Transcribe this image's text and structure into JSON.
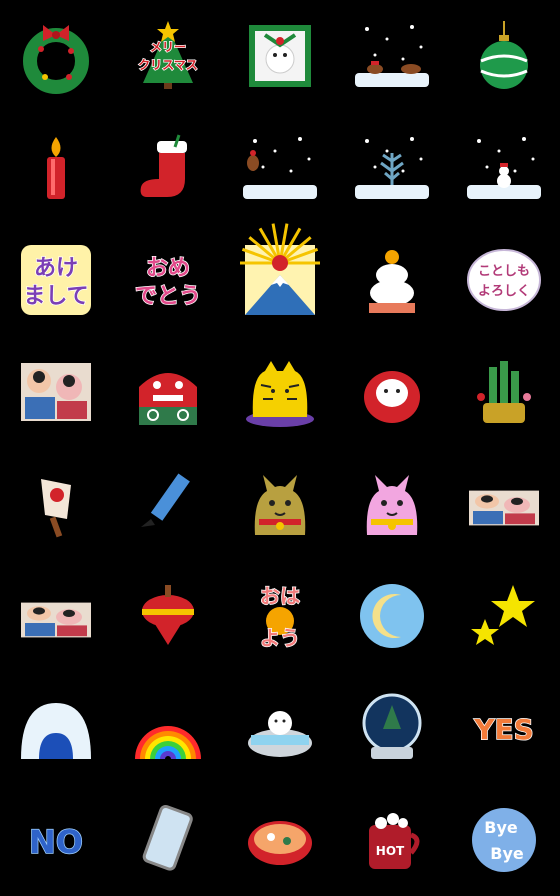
{
  "items": [
    {
      "name": "christmas-wreath-icon"
    },
    {
      "name": "christmas-tree-sticker",
      "text": "メリー クリスマス",
      "l1": "メリー",
      "l2": "クリスマス"
    },
    {
      "name": "gift-box-icon"
    },
    {
      "name": "reindeer-snow-scene-icon"
    },
    {
      "name": "green-ornament-icon"
    },
    {
      "name": "candle-icon"
    },
    {
      "name": "christmas-stocking-icon"
    },
    {
      "name": "reindeer-snowfall-icon"
    },
    {
      "name": "snowy-tree-icon"
    },
    {
      "name": "snowman-scene-icon"
    },
    {
      "name": "akemashite-omedetou-sticker",
      "text": "あけまして",
      "l1": "あけ",
      "l2": "まして"
    },
    {
      "name": "omedetou-sticker",
      "text": "おめでとう",
      "l1": "おめ",
      "l2": "でとう"
    },
    {
      "name": "mount-fuji-sunrise-icon"
    },
    {
      "name": "kagami-mochi-icon"
    },
    {
      "name": "kotoshimo-yoroshiku-sticker",
      "text": "ことしも よろしく",
      "l1": "ことしも",
      "l2": "よろしく"
    },
    {
      "name": "new-year-collage-icon"
    },
    {
      "name": "shishimai-lion-icon"
    },
    {
      "name": "tiger-icon"
    },
    {
      "name": "daruma-icon"
    },
    {
      "name": "kadomatsu-icon"
    },
    {
      "name": "hagoita-paddle-icon"
    },
    {
      "name": "calligraphy-brush-icon"
    },
    {
      "name": "gold-lucky-cat-icon"
    },
    {
      "name": "pink-lucky-cat-icon"
    },
    {
      "name": "new-year-collage-small-icon"
    },
    {
      "name": "people-collage-icon"
    },
    {
      "name": "spinning-top-icon"
    },
    {
      "name": "ohayo-sticker",
      "text": "おはよう",
      "l1": "おは",
      "l2": "よう"
    },
    {
      "name": "crescent-moon-icon"
    },
    {
      "name": "stars-icon"
    },
    {
      "name": "igloo-icon"
    },
    {
      "name": "rainbow-icon"
    },
    {
      "name": "hot-spring-snowman-icon"
    },
    {
      "name": "snow-globe-icon"
    },
    {
      "name": "yes-sticker",
      "text": "YES"
    },
    {
      "name": "no-sticker",
      "text": "NO"
    },
    {
      "name": "smartphone-icon"
    },
    {
      "name": "soup-bowl-icon"
    },
    {
      "name": "hot-cocoa-icon",
      "text": "HOT"
    },
    {
      "name": "bye-bye-sticker",
      "text": "Bye Bye",
      "l1": "Bye",
      "l2": "Bye"
    }
  ],
  "colors": {
    "background": "#000000",
    "red": "#d2232a",
    "green": "#1f8a3b",
    "gold": "#f5c400",
    "snow": "#e8f3fb"
  }
}
